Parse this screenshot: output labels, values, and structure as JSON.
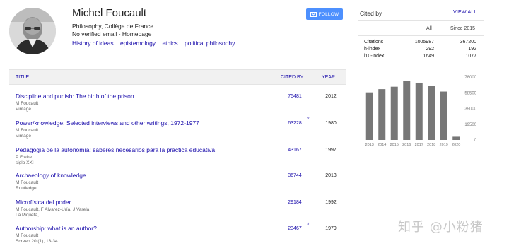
{
  "profile": {
    "name": "Michel Foucault",
    "affiliation": "Philosophy, Collège de France",
    "email_text": "No verified email - ",
    "homepage_label": "Homepage",
    "interests": [
      "History of ideas",
      "epistemology",
      "ethics",
      "political philosophy"
    ],
    "avatar_icon": "person-photo"
  },
  "follow_button": {
    "label": "FOLLOW",
    "icon": "envelope-icon",
    "color": "#4d90fe"
  },
  "table": {
    "headers": {
      "title": "TITLE",
      "cited_by": "CITED BY",
      "year": "YEAR"
    },
    "rows": [
      {
        "title": "Discipline and punish: The birth of the prison",
        "authors": "M Foucault",
        "venue": "Vintage",
        "cited_by": "75481",
        "star": "",
        "year": "2012"
      },
      {
        "title": "Power/knowledge: Selected interviews and other writings, 1972-1977",
        "authors": "M Foucault",
        "venue": "Vintage",
        "cited_by": "63228",
        "star": "*",
        "year": "1980"
      },
      {
        "title": "Pedagogía de la autonomía: saberes necesarios para la práctica educativa",
        "authors": "P Freire",
        "venue": "siglo XXI",
        "cited_by": "43167",
        "star": "",
        "year": "1997"
      },
      {
        "title": "Archaeology of knowledge",
        "authors": "M Foucault",
        "venue": "Routledge",
        "cited_by": "36744",
        "star": "",
        "year": "2013"
      },
      {
        "title": "Microfísica del poder",
        "authors": "M Foucault, F Alvarez-Uría, J Varela",
        "venue": "La Piqueta,",
        "cited_by": "29184",
        "star": "",
        "year": "1992"
      },
      {
        "title": "Authorship: what is an author?",
        "authors": "M Foucault",
        "venue": "Screen 20 (1), 13-34",
        "cited_by": "23467",
        "star": "*",
        "year": "1979"
      }
    ]
  },
  "cited_by_panel": {
    "label": "Cited by",
    "view_all": "VIEW ALL",
    "columns": {
      "all": "All",
      "since": "Since 2015"
    },
    "stats": [
      {
        "label": "Citations",
        "all": "1005987",
        "since": "367200"
      },
      {
        "label": "h-index",
        "all": "292",
        "since": "192"
      },
      {
        "label": "i10-index",
        "all": "1649",
        "since": "1077"
      }
    ]
  },
  "chart_data": {
    "type": "bar",
    "categories": [
      "2013",
      "2014",
      "2015",
      "2016",
      "2017",
      "2018",
      "2019",
      "2020"
    ],
    "values": [
      59000,
      63000,
      66000,
      73000,
      71000,
      67000,
      60000,
      4000
    ],
    "ylim": [
      0,
      78000
    ],
    "yticks": [
      "78000",
      "58500",
      "39000",
      "19500",
      "0"
    ],
    "ytick_values": [
      78000,
      58500,
      39000,
      19500,
      0
    ],
    "bar_color": "#777777",
    "grid": false
  },
  "watermark": "知乎 @小粉猪"
}
